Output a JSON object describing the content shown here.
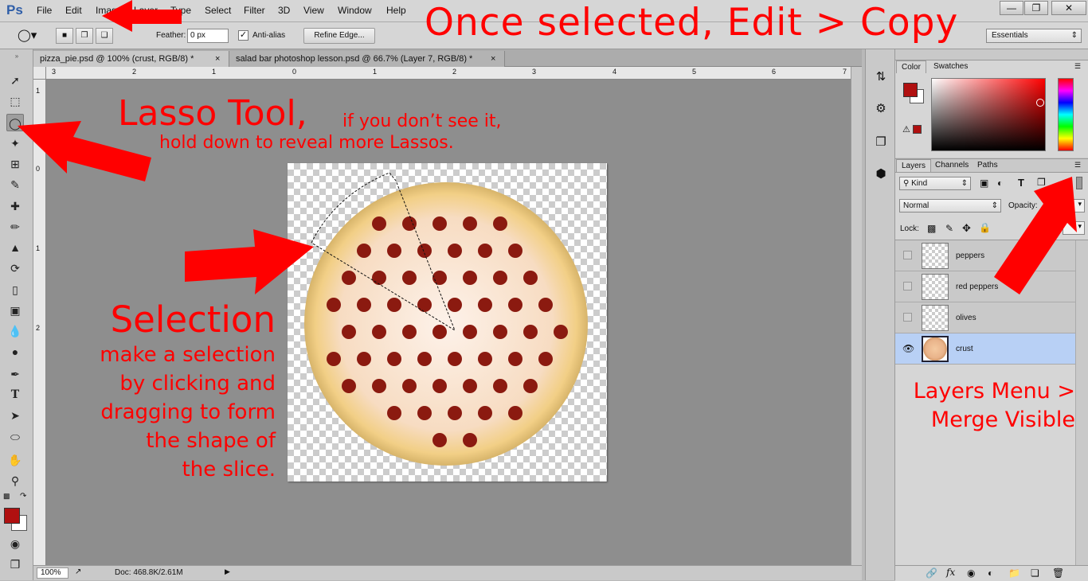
{
  "app": {
    "logo": "Ps"
  },
  "menu": [
    "File",
    "Edit",
    "Image",
    "Layer",
    "Type",
    "Select",
    "Filter",
    "3D",
    "View",
    "Window",
    "Help"
  ],
  "options_bar": {
    "feather_label": "Feather:",
    "feather_value": "0 px",
    "antialias_label": "Anti-alias",
    "refine_edge": "Refine Edge...",
    "workspace": "Essentials"
  },
  "doc_tabs": [
    {
      "label": "pizza_pie.psd @ 100% (crust, RGB/8) *",
      "active": true
    },
    {
      "label": "salad bar photoshop lesson.psd @ 66.7% (Layer 7, RGB/8) *",
      "active": false
    }
  ],
  "rulers": {
    "h": [
      "3",
      "2",
      "1",
      "0",
      "1",
      "2",
      "3",
      "4",
      "5",
      "6",
      "7"
    ],
    "v": [
      "1",
      "0",
      "1",
      "2"
    ]
  },
  "status": {
    "zoom": "100%",
    "doc_info": "Doc: 468.8K/2.61M"
  },
  "color_panel": {
    "tabs": [
      "Color",
      "Swatches"
    ],
    "fg": "#b01010",
    "bg": "#ffffff"
  },
  "layers_panel": {
    "tabs": [
      "Layers",
      "Channels",
      "Paths"
    ],
    "kind": "Kind",
    "blend_mode": "Normal",
    "opacity_label": "Opacity:",
    "lock_label": "Lock:",
    "layers": [
      {
        "name": "peppers",
        "visible": false,
        "selected": false
      },
      {
        "name": "red peppers",
        "visible": false,
        "selected": false
      },
      {
        "name": "olives",
        "visible": false,
        "selected": false
      },
      {
        "name": "crust",
        "visible": true,
        "selected": true
      }
    ]
  },
  "annotations": {
    "top": "Once selected, Edit > Copy",
    "lasso_title": "Lasso Tool,",
    "lasso_sub1": "if you don’t see it,",
    "lasso_sub2": "hold down to reveal more Lassos.",
    "selection_title": "Selection",
    "selection_lines": [
      "make a selection",
      "by clicking and",
      "dragging to form",
      "the shape of",
      "the slice."
    ],
    "layers_line1": "Layers Menu >",
    "layers_line2": "Merge Visible"
  },
  "colors": {
    "annotation": "#ff0000",
    "selected_layer": "#b8d0f5",
    "canvas_bg": "#8e8e8e"
  }
}
